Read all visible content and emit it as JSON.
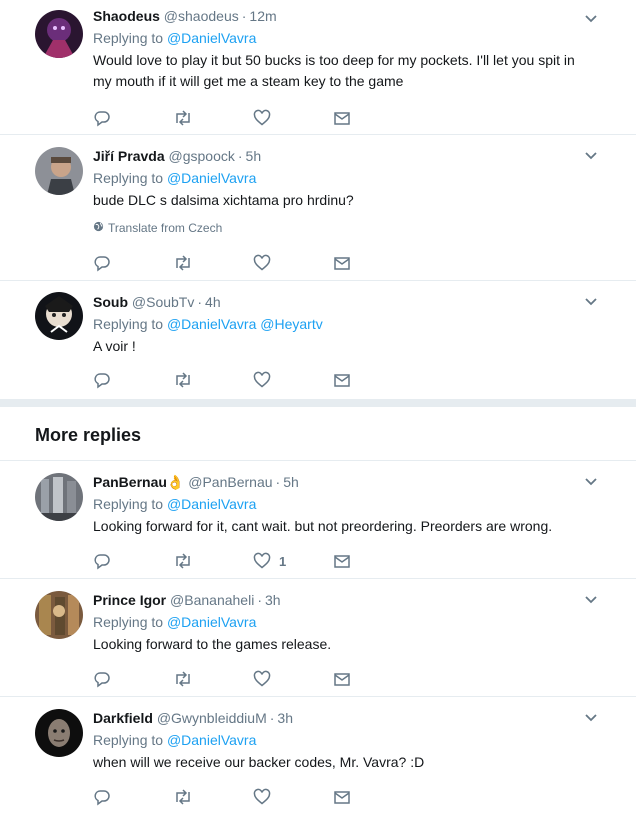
{
  "tweets_top": [
    {
      "name": "Shaodeus",
      "handle": "@shaodeus",
      "time": "12m",
      "replying_prefix": "Replying to",
      "mentions": [
        "@DanielVavra"
      ],
      "text": "Would love to play it but 50 bucks is too deep for my pockets. I'll let you spit in my mouth if it will get me a steam key to the game",
      "like_count": "",
      "translate": ""
    },
    {
      "name": "Jiří Pravda",
      "handle": "@gspoock",
      "time": "5h",
      "replying_prefix": "Replying to",
      "mentions": [
        "@DanielVavra"
      ],
      "text": "bude DLC s dalsima xichtama pro hrdinu?",
      "like_count": "",
      "translate": "Translate from Czech"
    },
    {
      "name": "Soub",
      "handle": "@SoubTv",
      "time": "4h",
      "replying_prefix": "Replying to",
      "mentions": [
        "@DanielVavra",
        "@Heyartv"
      ],
      "text": "A voir !",
      "like_count": "",
      "translate": ""
    }
  ],
  "more_replies_title": "More replies",
  "tweets_more": [
    {
      "name": "PanBernau",
      "name_emoji": "👌",
      "handle": "@PanBernau",
      "time": "5h",
      "replying_prefix": "Replying to",
      "mentions": [
        "@DanielVavra"
      ],
      "text": "Looking forward for it, cant wait. but not preordering. Preorders are wrong.",
      "like_count": "1"
    },
    {
      "name": "Prince Igor",
      "handle": "@Bananaheli",
      "time": "3h",
      "replying_prefix": "Replying to",
      "mentions": [
        "@DanielVavra"
      ],
      "text": "Looking forward to the games release.",
      "like_count": ""
    },
    {
      "name": "Darkfield",
      "handle": "@GwynbleiddiuM",
      "time": "3h",
      "replying_prefix": "Replying to",
      "mentions": [
        "@DanielVavra"
      ],
      "text": "when will we receive our backer codes, Mr. Vavra? :D",
      "like_count": ""
    }
  ],
  "icons": {
    "reply": "reply-icon",
    "retweet": "retweet-icon",
    "like": "heart-icon",
    "dm": "envelope-icon",
    "caret": "chevron-down-icon",
    "globe": "globe-icon"
  },
  "colors": {
    "link": "#1da1f2",
    "muted": "#657786",
    "border": "#e6ecf0",
    "text": "#14171a"
  }
}
